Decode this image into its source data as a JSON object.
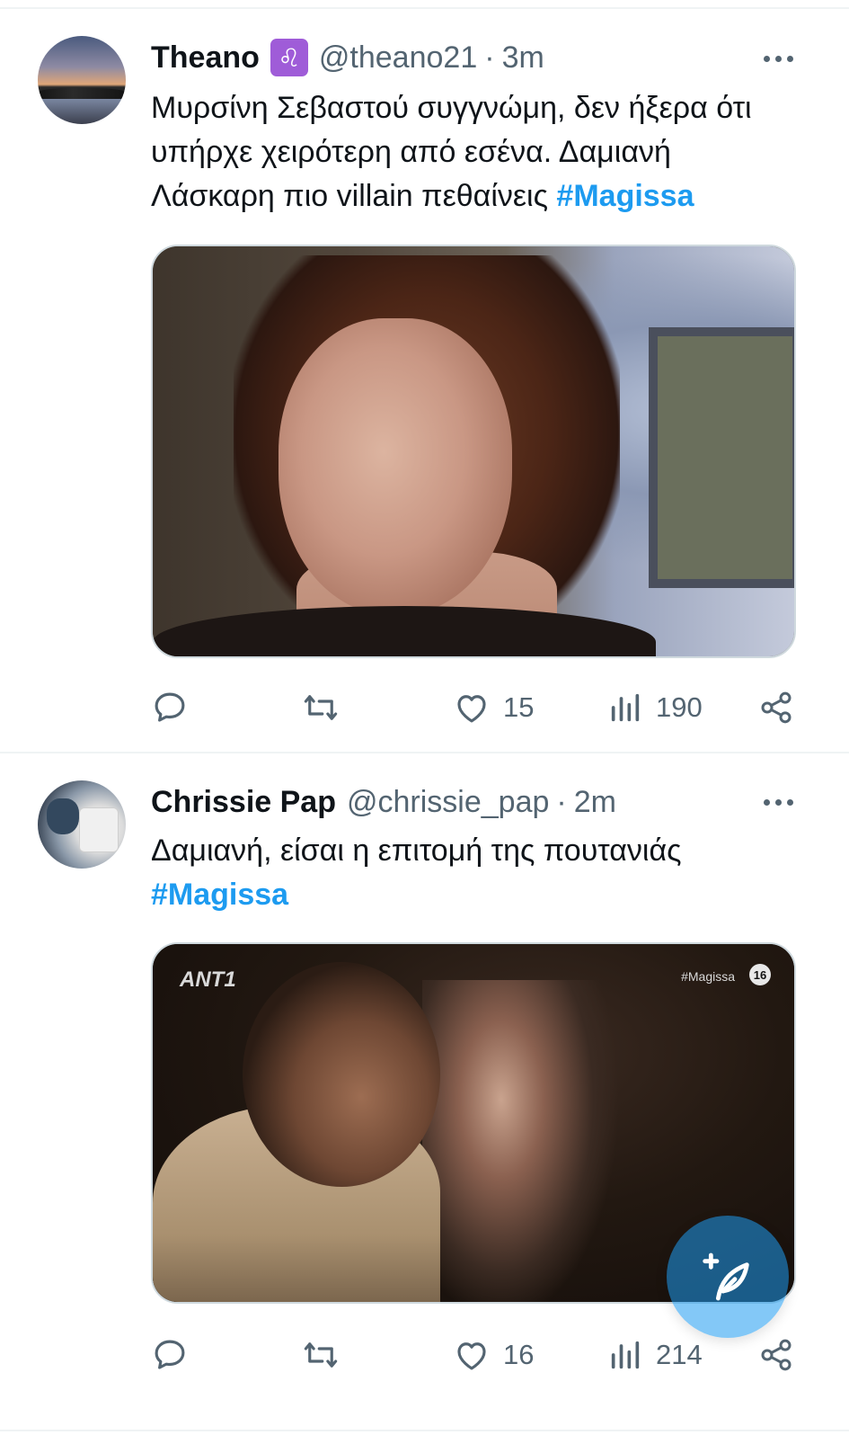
{
  "tweets": [
    {
      "name": "Theano",
      "badge": "♌",
      "handle": "@theano21",
      "separator": "·",
      "time": "3m",
      "text": "Μυρσίνη Σεβαστού συγγνώμη, δεν ήξερα ότι υπήρχε χειρότερη από εσένα. Δαμιανή Λάσκαρη πιο villain πεθαίνεις ",
      "hashtag": "#Magissa",
      "likes": "15",
      "views": "190"
    },
    {
      "name": "Chrissie Pap",
      "handle": "@chrissie_pap",
      "separator": "·",
      "time": "2m",
      "text": "Δαμιανή, είσαι η επιτομή της πουτανιάς",
      "hashtag": "#Magissa",
      "likes": "16",
      "views": "214",
      "media_overlay": {
        "logo": "ANT1",
        "tag": "#Magissa",
        "rating": "16"
      }
    }
  ],
  "colors": {
    "accent": "#1d9bf0",
    "secondary_text": "#536471",
    "badge": "#9f5cd8",
    "divider": "#eff3f4"
  },
  "icons": [
    "reply-icon",
    "retweet-icon",
    "like-icon",
    "views-icon",
    "share-icon",
    "more-icon",
    "compose-icon"
  ]
}
